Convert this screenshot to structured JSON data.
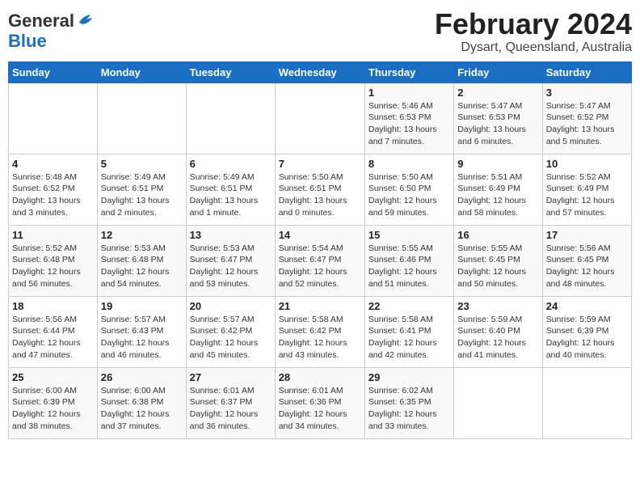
{
  "header": {
    "logo_line1": "General",
    "logo_line2": "Blue",
    "title": "February 2024",
    "subtitle": "Dysart, Queensland, Australia"
  },
  "days_of_week": [
    "Sunday",
    "Monday",
    "Tuesday",
    "Wednesday",
    "Thursday",
    "Friday",
    "Saturday"
  ],
  "weeks": [
    [
      {
        "day": "",
        "info": ""
      },
      {
        "day": "",
        "info": ""
      },
      {
        "day": "",
        "info": ""
      },
      {
        "day": "",
        "info": ""
      },
      {
        "day": "1",
        "info": "Sunrise: 5:46 AM\nSunset: 6:53 PM\nDaylight: 13 hours\nand 7 minutes."
      },
      {
        "day": "2",
        "info": "Sunrise: 5:47 AM\nSunset: 6:53 PM\nDaylight: 13 hours\nand 6 minutes."
      },
      {
        "day": "3",
        "info": "Sunrise: 5:47 AM\nSunset: 6:52 PM\nDaylight: 13 hours\nand 5 minutes."
      }
    ],
    [
      {
        "day": "4",
        "info": "Sunrise: 5:48 AM\nSunset: 6:52 PM\nDaylight: 13 hours\nand 3 minutes."
      },
      {
        "day": "5",
        "info": "Sunrise: 5:49 AM\nSunset: 6:51 PM\nDaylight: 13 hours\nand 2 minutes."
      },
      {
        "day": "6",
        "info": "Sunrise: 5:49 AM\nSunset: 6:51 PM\nDaylight: 13 hours\nand 1 minute."
      },
      {
        "day": "7",
        "info": "Sunrise: 5:50 AM\nSunset: 6:51 PM\nDaylight: 13 hours\nand 0 minutes."
      },
      {
        "day": "8",
        "info": "Sunrise: 5:50 AM\nSunset: 6:50 PM\nDaylight: 12 hours\nand 59 minutes."
      },
      {
        "day": "9",
        "info": "Sunrise: 5:51 AM\nSunset: 6:49 PM\nDaylight: 12 hours\nand 58 minutes."
      },
      {
        "day": "10",
        "info": "Sunrise: 5:52 AM\nSunset: 6:49 PM\nDaylight: 12 hours\nand 57 minutes."
      }
    ],
    [
      {
        "day": "11",
        "info": "Sunrise: 5:52 AM\nSunset: 6:48 PM\nDaylight: 12 hours\nand 56 minutes."
      },
      {
        "day": "12",
        "info": "Sunrise: 5:53 AM\nSunset: 6:48 PM\nDaylight: 12 hours\nand 54 minutes."
      },
      {
        "day": "13",
        "info": "Sunrise: 5:53 AM\nSunset: 6:47 PM\nDaylight: 12 hours\nand 53 minutes."
      },
      {
        "day": "14",
        "info": "Sunrise: 5:54 AM\nSunset: 6:47 PM\nDaylight: 12 hours\nand 52 minutes."
      },
      {
        "day": "15",
        "info": "Sunrise: 5:55 AM\nSunset: 6:46 PM\nDaylight: 12 hours\nand 51 minutes."
      },
      {
        "day": "16",
        "info": "Sunrise: 5:55 AM\nSunset: 6:45 PM\nDaylight: 12 hours\nand 50 minutes."
      },
      {
        "day": "17",
        "info": "Sunrise: 5:56 AM\nSunset: 6:45 PM\nDaylight: 12 hours\nand 48 minutes."
      }
    ],
    [
      {
        "day": "18",
        "info": "Sunrise: 5:56 AM\nSunset: 6:44 PM\nDaylight: 12 hours\nand 47 minutes."
      },
      {
        "day": "19",
        "info": "Sunrise: 5:57 AM\nSunset: 6:43 PM\nDaylight: 12 hours\nand 46 minutes."
      },
      {
        "day": "20",
        "info": "Sunrise: 5:57 AM\nSunset: 6:42 PM\nDaylight: 12 hours\nand 45 minutes."
      },
      {
        "day": "21",
        "info": "Sunrise: 5:58 AM\nSunset: 6:42 PM\nDaylight: 12 hours\nand 43 minutes."
      },
      {
        "day": "22",
        "info": "Sunrise: 5:58 AM\nSunset: 6:41 PM\nDaylight: 12 hours\nand 42 minutes."
      },
      {
        "day": "23",
        "info": "Sunrise: 5:59 AM\nSunset: 6:40 PM\nDaylight: 12 hours\nand 41 minutes."
      },
      {
        "day": "24",
        "info": "Sunrise: 5:59 AM\nSunset: 6:39 PM\nDaylight: 12 hours\nand 40 minutes."
      }
    ],
    [
      {
        "day": "25",
        "info": "Sunrise: 6:00 AM\nSunset: 6:39 PM\nDaylight: 12 hours\nand 38 minutes."
      },
      {
        "day": "26",
        "info": "Sunrise: 6:00 AM\nSunset: 6:38 PM\nDaylight: 12 hours\nand 37 minutes."
      },
      {
        "day": "27",
        "info": "Sunrise: 6:01 AM\nSunset: 6:37 PM\nDaylight: 12 hours\nand 36 minutes."
      },
      {
        "day": "28",
        "info": "Sunrise: 6:01 AM\nSunset: 6:36 PM\nDaylight: 12 hours\nand 34 minutes."
      },
      {
        "day": "29",
        "info": "Sunrise: 6:02 AM\nSunset: 6:35 PM\nDaylight: 12 hours\nand 33 minutes."
      },
      {
        "day": "",
        "info": ""
      },
      {
        "day": "",
        "info": ""
      }
    ]
  ]
}
